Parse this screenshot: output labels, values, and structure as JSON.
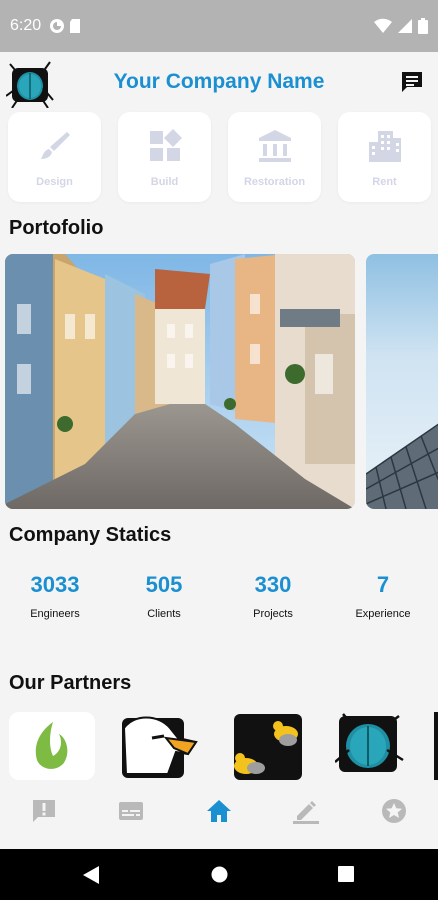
{
  "status_bar": {
    "time": "6:20"
  },
  "app_bar": {
    "title": "Your Company Name"
  },
  "services": [
    {
      "label": "Design",
      "icon": "brush-icon"
    },
    {
      "label": "Build",
      "icon": "build-blocks-icon"
    },
    {
      "label": "Restoration",
      "icon": "bank-building-icon"
    },
    {
      "label": "Rent",
      "icon": "city-building-icon"
    }
  ],
  "portfolio": {
    "title": "Portofolio"
  },
  "stats": {
    "title": "Company Statics",
    "items": [
      {
        "value": "3033",
        "label": "Engineers"
      },
      {
        "value": "505",
        "label": "Clients"
      },
      {
        "value": "330",
        "label": "Projects"
      },
      {
        "value": "7",
        "label": "Experience"
      }
    ]
  },
  "partners": {
    "title": "Our Partners"
  },
  "bottom_nav": [
    {
      "name": "alert-icon"
    },
    {
      "name": "subtitles-icon"
    },
    {
      "name": "home-icon",
      "active": true
    },
    {
      "name": "edit-icon"
    },
    {
      "name": "star-icon"
    }
  ],
  "colors": {
    "accent": "#1a8fd1",
    "service_label": "#d3d6e4",
    "nav_inactive": "#b9b9b9"
  }
}
